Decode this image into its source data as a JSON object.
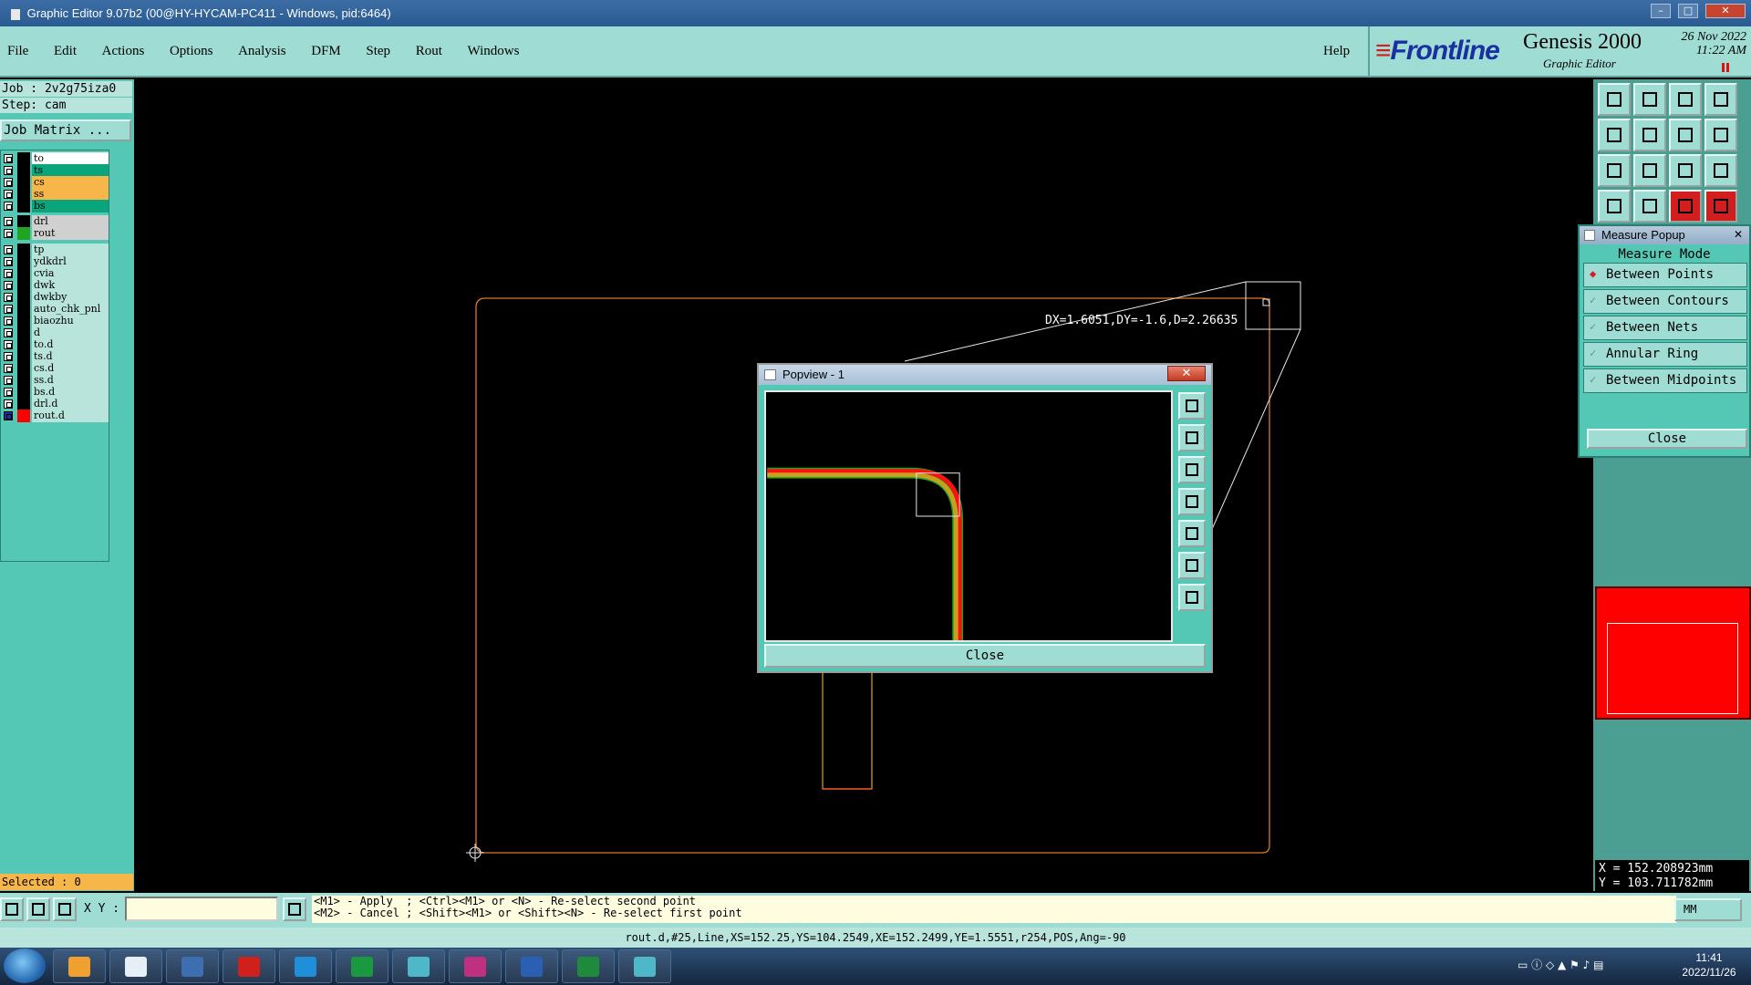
{
  "window": {
    "title": "Graphic Editor 9.07b2 (00@HY-HYCAM-PC411 - Windows, pid:6464)",
    "min_glyph": "–",
    "max_glyph": "□",
    "close_glyph": "✕"
  },
  "menubar": {
    "items": [
      "File",
      "Edit",
      "Actions",
      "Options",
      "Analysis",
      "DFM",
      "Step",
      "Rout",
      "Windows"
    ],
    "help": "Help"
  },
  "brand": {
    "logo": "Frontline",
    "product": "Genesis 2000",
    "subtitle": "Graphic Editor",
    "date": "26 Nov 2022",
    "time": "11:22 AM"
  },
  "left": {
    "job": "Job : 2v2g75iza0",
    "step": "Step: cam",
    "job_matrix": "Job Matrix ...",
    "layers": [
      {
        "name": "to",
        "color": "#000000",
        "bg": "#ffffff"
      },
      {
        "name": "ts",
        "color": "#000000",
        "bg": "#0aa57c"
      },
      {
        "name": "cs",
        "color": "#000000",
        "bg": "#f6b64a"
      },
      {
        "name": "ss",
        "color": "#000000",
        "bg": "#f6b64a"
      },
      {
        "name": "bs",
        "color": "#000000",
        "bg": "#0aa57c"
      },
      {
        "name": "drl",
        "color": "#000000",
        "bg": "#d0d0d0"
      },
      {
        "name": "rout",
        "color": "#1fa51f",
        "bg": "#d0d0d0"
      },
      {
        "name": "tp",
        "color": "#000000",
        "bg": "#b8e4dc"
      },
      {
        "name": "ydkdrl",
        "color": "#000000",
        "bg": "#b8e4dc"
      },
      {
        "name": "cvia",
        "color": "#000000",
        "bg": "#b8e4dc"
      },
      {
        "name": "dwk",
        "color": "#000000",
        "bg": "#b8e4dc"
      },
      {
        "name": "dwkby",
        "color": "#000000",
        "bg": "#b8e4dc"
      },
      {
        "name": "auto_chk_pnl",
        "color": "#000000",
        "bg": "#b8e4dc"
      },
      {
        "name": "biaozhu",
        "color": "#000000",
        "bg": "#b8e4dc"
      },
      {
        "name": "d",
        "color": "#000000",
        "bg": "#b8e4dc"
      },
      {
        "name": "to.d",
        "color": "#000000",
        "bg": "#b8e4dc"
      },
      {
        "name": "ts.d",
        "color": "#000000",
        "bg": "#b8e4dc"
      },
      {
        "name": "cs.d",
        "color": "#000000",
        "bg": "#b8e4dc"
      },
      {
        "name": "ss.d",
        "color": "#000000",
        "bg": "#b8e4dc"
      },
      {
        "name": "bs.d",
        "color": "#000000",
        "bg": "#b8e4dc"
      },
      {
        "name": "drl.d",
        "color": "#000000",
        "bg": "#b8e4dc"
      },
      {
        "name": "rout.d",
        "color": "#ff0000",
        "bg": "#b8e4dc",
        "active": true
      }
    ],
    "selected": "Selected : 0"
  },
  "canvas": {
    "measure_label": "DX=1.6051,DY=-1.6,D=2.26635"
  },
  "measure_popup": {
    "title": "Measure Popup",
    "close_x": "✕",
    "mode_header": "Measure Mode",
    "options": [
      {
        "label": "Between Points",
        "selected": true
      },
      {
        "label": "Between Contours",
        "selected": false
      },
      {
        "label": "Between Nets",
        "selected": false
      },
      {
        "label": "Annular Ring",
        "selected": false
      },
      {
        "label": "Between Midpoints",
        "selected": false
      }
    ],
    "close": "Close"
  },
  "popview": {
    "title": "Popview - 1",
    "close_x": "✕",
    "close": "Close"
  },
  "right": {
    "coord_x": "X = 152.208923mm",
    "coord_y": "Y = 103.711782mm",
    "active_color": "#ff0000"
  },
  "bottom": {
    "xy_label": "X Y :",
    "xy_value": "",
    "instructions_line1": "<M1> - Apply  ; <Ctrl><M1> or <N> - Re-select second point",
    "instructions_line2": "<M2> - Cancel ; <Shift><M1> or <Shift><N> - Re-select first point",
    "units": "MM",
    "status": "rout.d,#25,Line,XS=152.25,YS=104.2549,XE=152.2499,YE=1.5551,r254,POS,Ang=-90"
  },
  "taskbar": {
    "time": "11:41",
    "date": "2022/11/26"
  }
}
